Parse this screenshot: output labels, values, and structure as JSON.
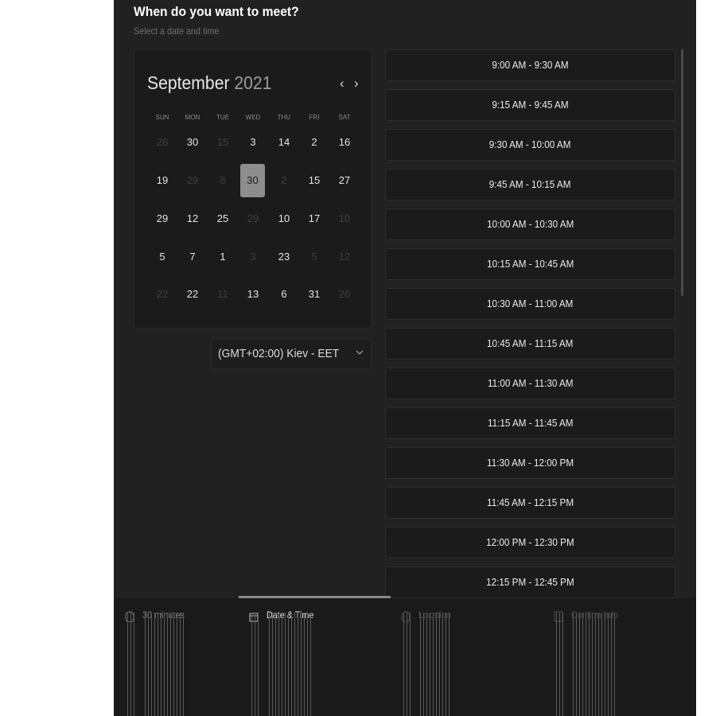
{
  "header": {
    "title": "When do you want to meet?",
    "subtitle": "Select a date and time"
  },
  "calendar": {
    "month": "September",
    "year": "2021",
    "prev_icon": "chevron-left-icon",
    "next_icon": "chevron-right-icon",
    "weekdays": [
      "SUN",
      "MON",
      "TUE",
      "WED",
      "THU",
      "FRI",
      "SAT"
    ],
    "selected": "30",
    "weeks": [
      [
        {
          "d": "28",
          "m": true
        },
        {
          "d": "30",
          "m": false
        },
        {
          "d": "15",
          "m": true
        },
        {
          "d": "3",
          "m": false
        },
        {
          "d": "14",
          "m": false
        },
        {
          "d": "2",
          "m": false
        },
        {
          "d": "16",
          "m": false
        }
      ],
      [
        {
          "d": "19",
          "m": false
        },
        {
          "d": "29",
          "m": true
        },
        {
          "d": "8",
          "m": true
        },
        {
          "d": "30",
          "m": false,
          "sel": true
        },
        {
          "d": "2",
          "m": true
        },
        {
          "d": "15",
          "m": false
        },
        {
          "d": "27",
          "m": false
        }
      ],
      [
        {
          "d": "29",
          "m": false
        },
        {
          "d": "12",
          "m": false
        },
        {
          "d": "25",
          "m": false
        },
        {
          "d": "29",
          "m": true
        },
        {
          "d": "10",
          "m": false
        },
        {
          "d": "17",
          "m": false
        },
        {
          "d": "10",
          "m": true
        }
      ],
      [
        {
          "d": "5",
          "m": false
        },
        {
          "d": "7",
          "m": false
        },
        {
          "d": "1",
          "m": false
        },
        {
          "d": "3",
          "m": true
        },
        {
          "d": "23",
          "m": false
        },
        {
          "d": "5",
          "m": true
        },
        {
          "d": "12",
          "m": true
        }
      ],
      [
        {
          "d": "22",
          "m": true
        },
        {
          "d": "22",
          "m": false
        },
        {
          "d": "11",
          "m": true
        },
        {
          "d": "13",
          "m": false
        },
        {
          "d": "6",
          "m": false
        },
        {
          "d": "31",
          "m": false
        },
        {
          "d": "26",
          "m": true
        }
      ]
    ]
  },
  "timezone": {
    "label": "(GMT+02:00) Kiev - EET",
    "icon": "chevron-down-icon"
  },
  "time_slots": [
    "9:00 AM - 9:30 AM",
    "9:15 AM - 9:45 AM",
    "9:30 AM - 10:00 AM",
    "9:45 AM - 10:15 AM",
    "10:00 AM - 10:30 AM",
    "10:15 AM - 10:45 AM",
    "10:30 AM - 11:00 AM",
    "10:45 AM - 11:15 AM",
    "11:00 AM - 11:30 AM",
    "11:15 AM - 11:45 AM",
    "11:30 AM - 12:00 PM",
    "11:45 AM - 12:15 PM",
    "12:00 PM - 12:30 PM",
    "12:15 PM - 12:45 PM"
  ],
  "steps": [
    {
      "label": "30 minutes",
      "icon": "clock-icon",
      "active": false
    },
    {
      "label": "Date & Time",
      "icon": "calendar-icon",
      "active": true
    },
    {
      "label": "Location",
      "icon": "location-pin-icon",
      "active": false
    },
    {
      "label": "Confirm Info",
      "icon": "checkbox-icon",
      "active": false
    }
  ],
  "colors": {
    "panel": "#212121",
    "selected_day": "#8d8d8d",
    "active_tab": "#8a8a8a"
  }
}
